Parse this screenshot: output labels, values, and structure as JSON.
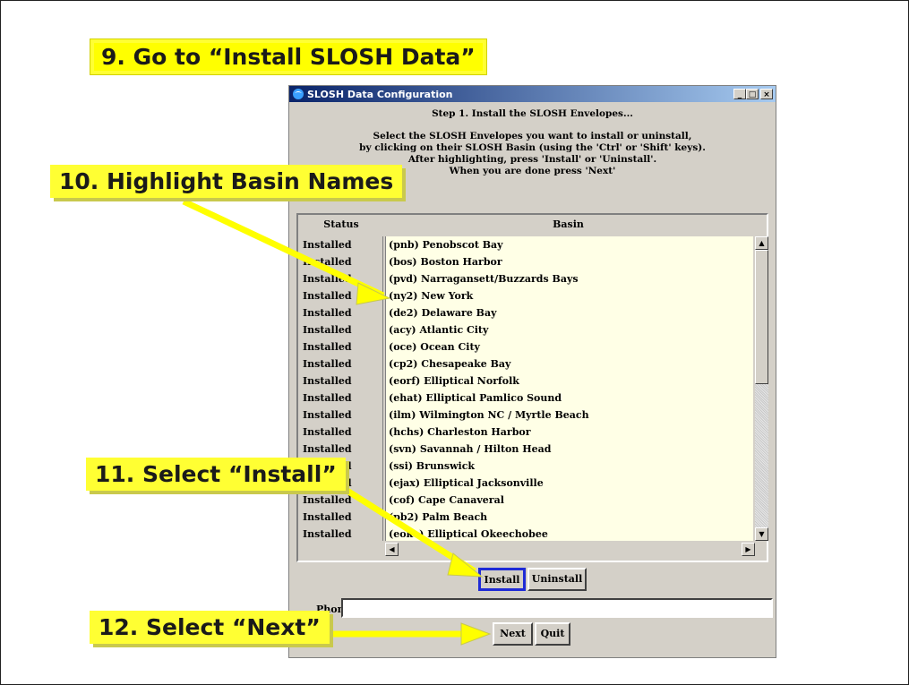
{
  "callouts": {
    "step9": "9. Go to “Install SLOSH Data”",
    "step10": "10. Highlight Basin Names",
    "step11": "11. Select “Install”",
    "step12": "12. Select “Next”"
  },
  "window": {
    "title": "SLOSH Data Configuration",
    "buttons": {
      "minimize": "_",
      "maximize": "□",
      "close": "×"
    },
    "step_heading": "Step 1. Install the SLOSH Envelopes...",
    "instructions": [
      "Select the SLOSH Envelopes you want to install or uninstall,",
      "by clicking on their SLOSH Basin (using the 'Ctrl' or 'Shift' keys).",
      "After highlighting, press 'Install' or 'Uninstall'.",
      "When you are done press 'Next'"
    ]
  },
  "table": {
    "columns": {
      "status": "Status",
      "basin": "Basin"
    },
    "rows": [
      {
        "status": "Installed",
        "basin": "(pnb) Penobscot Bay"
      },
      {
        "status": "Installed",
        "basin": "(bos) Boston Harbor"
      },
      {
        "status": "Installed",
        "basin": "(pvd) Narragansett/Buzzards Bays"
      },
      {
        "status": "Installed",
        "basin": "(ny2) New York"
      },
      {
        "status": "Installed",
        "basin": "(de2) Delaware Bay"
      },
      {
        "status": "Installed",
        "basin": "(acy) Atlantic City"
      },
      {
        "status": "Installed",
        "basin": "(oce) Ocean City"
      },
      {
        "status": "Installed",
        "basin": "(cp2) Chesapeake Bay"
      },
      {
        "status": "Installed",
        "basin": "(eorf) Elliptical Norfolk"
      },
      {
        "status": "Installed",
        "basin": "(ehat) Elliptical Pamlico Sound"
      },
      {
        "status": "Installed",
        "basin": "(ilm) Wilmington NC / Myrtle Beach"
      },
      {
        "status": "Installed",
        "basin": "(hchs) Charleston Harbor"
      },
      {
        "status": "Installed",
        "basin": "(svn) Savannah / Hilton Head"
      },
      {
        "status": "Installed",
        "basin": "(ssi) Brunswick"
      },
      {
        "status": "Installed",
        "basin": "(ejax) Elliptical Jacksonville"
      },
      {
        "status": "Installed",
        "basin": "(cof) Cape Canaveral"
      },
      {
        "status": "Installed",
        "basin": "(pb2) Palm Beach"
      },
      {
        "status": "Installed",
        "basin": "(eoke) Elliptical Okeechobee"
      }
    ]
  },
  "actions": {
    "install": "Install",
    "uninstall": "Uninstall",
    "next": "Next",
    "quit": "Quit"
  },
  "phone": {
    "label": "Phone",
    "value": ""
  },
  "colors": {
    "callout": "#ffff33",
    "titlebar": "#0a246a",
    "list_bg": "#ffffe6",
    "focus": "#1f2bd6"
  }
}
